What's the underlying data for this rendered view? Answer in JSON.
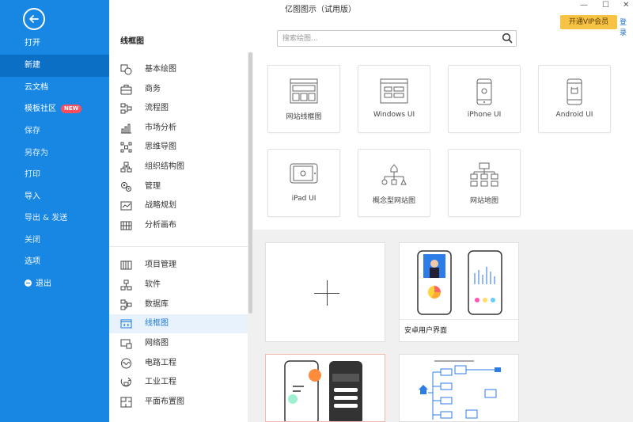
{
  "app": {
    "title": "亿图图示（试用版）",
    "vip_label": "开通VIP会员",
    "login_label": "登录"
  },
  "window": {
    "minimize": "—",
    "maximize": "☐",
    "close": "✕"
  },
  "sidebar": {
    "items": [
      {
        "label": "打开"
      },
      {
        "label": "新建",
        "active": true
      },
      {
        "label": "云文档"
      },
      {
        "label": "模板社区",
        "badge": "NEW"
      },
      {
        "label": "保存"
      },
      {
        "label": "另存为"
      },
      {
        "label": "打印"
      },
      {
        "label": "导入"
      },
      {
        "label": "导出 & 发送"
      },
      {
        "label": "关闭"
      },
      {
        "label": "选项"
      },
      {
        "label": "退出"
      }
    ]
  },
  "category_header": "线框图",
  "search": {
    "placeholder": "搜索绘图...",
    "value": ""
  },
  "categories": [
    {
      "label": "基本绘图",
      "icon": "basic-drawing-icon"
    },
    {
      "label": "商务",
      "icon": "briefcase-icon"
    },
    {
      "label": "流程图",
      "icon": "flowchart-icon"
    },
    {
      "label": "市场分析",
      "icon": "bar-chart-icon"
    },
    {
      "label": "思维导图",
      "icon": "mindmap-icon"
    },
    {
      "label": "组织结构图",
      "icon": "org-chart-icon"
    },
    {
      "label": "管理",
      "icon": "gears-icon"
    },
    {
      "label": "战略规划",
      "icon": "strategy-icon"
    },
    {
      "label": "分析画布",
      "icon": "canvas-icon"
    },
    {
      "label": "项目管理",
      "icon": "gantt-icon"
    },
    {
      "label": "软件",
      "icon": "software-icon"
    },
    {
      "label": "数据库",
      "icon": "database-icon"
    },
    {
      "label": "线框图",
      "icon": "wireframe-icon",
      "active": true
    },
    {
      "label": "网络图",
      "icon": "network-icon"
    },
    {
      "label": "电路工程",
      "icon": "circuit-icon"
    },
    {
      "label": "工业工程",
      "icon": "industrial-icon"
    },
    {
      "label": "平面布置图",
      "icon": "floorplan-icon"
    }
  ],
  "templates": [
    {
      "label": "网站线框图",
      "icon": "website-wireframe-icon"
    },
    {
      "label": "Windows UI",
      "icon": "windows-ui-icon"
    },
    {
      "label": "iPhone UI",
      "icon": "iphone-icon"
    },
    {
      "label": "Android UI",
      "icon": "android-icon"
    },
    {
      "label": "iPad UI",
      "icon": "ipad-icon"
    },
    {
      "label": "概念型网站图",
      "icon": "concept-site-icon"
    },
    {
      "label": "网站地图",
      "icon": "sitemap-icon"
    }
  ],
  "examples": [
    {
      "caption": "安卓用户界面"
    }
  ],
  "colors": {
    "sidebar": "#1787e3",
    "sidebar_active": "#0b6fc6",
    "vip": "#f6c344",
    "accent": "#1b78d6"
  }
}
